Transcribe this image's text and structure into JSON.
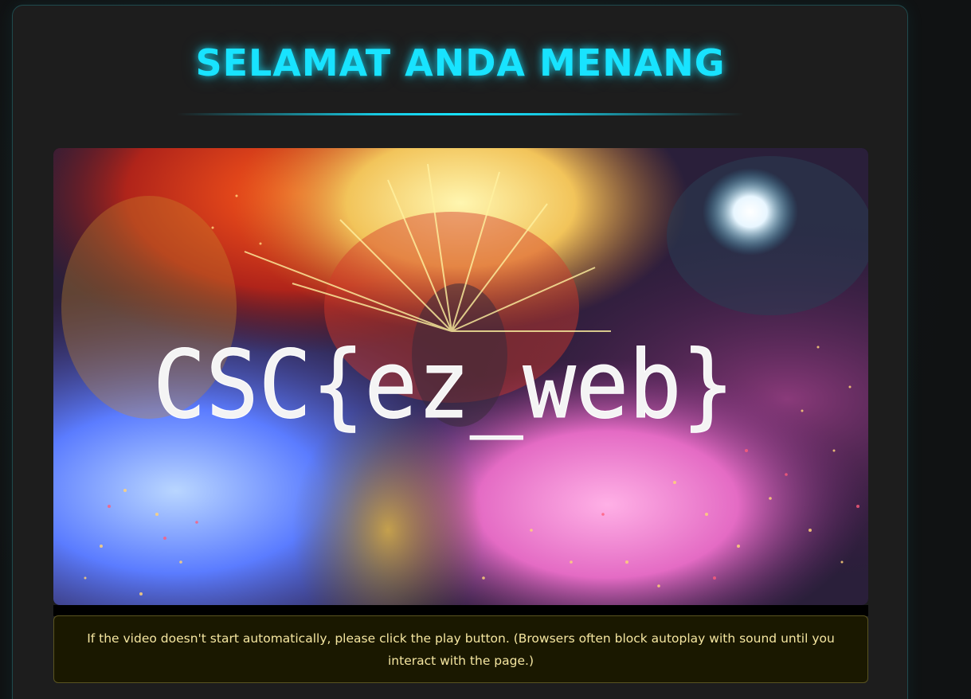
{
  "page": {
    "title": "SELAMAT ANDA MENANG"
  },
  "video": {
    "overlay_text": "CSC{ez_web}"
  },
  "notice": {
    "text": "If the video doesn't start automatically, please click the play button. (Browsers often block autoplay with sound until you interact with the page.)"
  },
  "colors": {
    "accent": "#18e3ff",
    "notice_text": "#f5e6a0",
    "card_bg": "#1d1d1d"
  }
}
